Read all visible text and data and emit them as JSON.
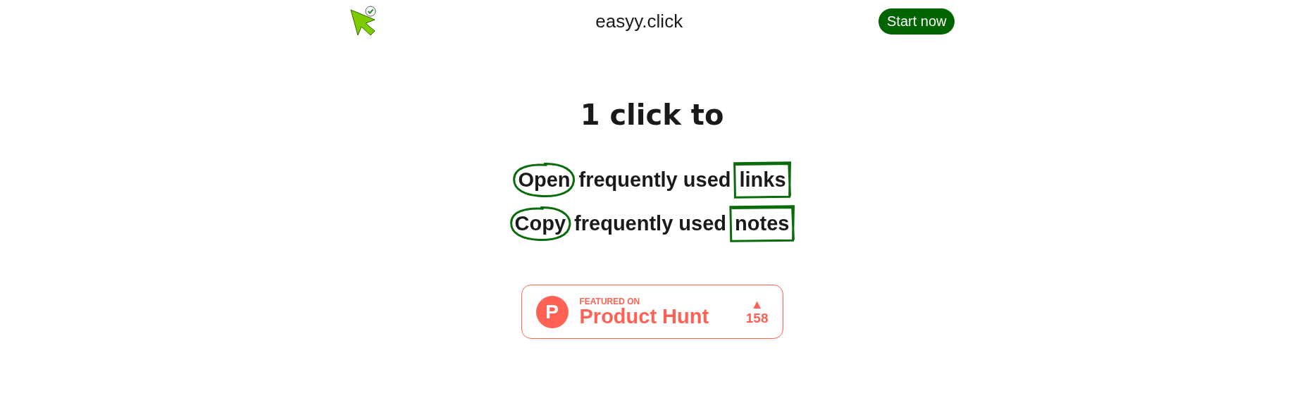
{
  "header": {
    "site_name": "easyy.click",
    "cta": "Start now"
  },
  "heading": "1 click to",
  "lines": [
    {
      "action": "Open",
      "middle": "frequently used",
      "object": "links"
    },
    {
      "action": "Copy",
      "middle": "frequently used",
      "object": "notes"
    }
  ],
  "badge": {
    "logo_letter": "P",
    "caption": "FEATURED ON",
    "name": "Product Hunt",
    "votes_arrow": "▲",
    "votes": "158"
  }
}
